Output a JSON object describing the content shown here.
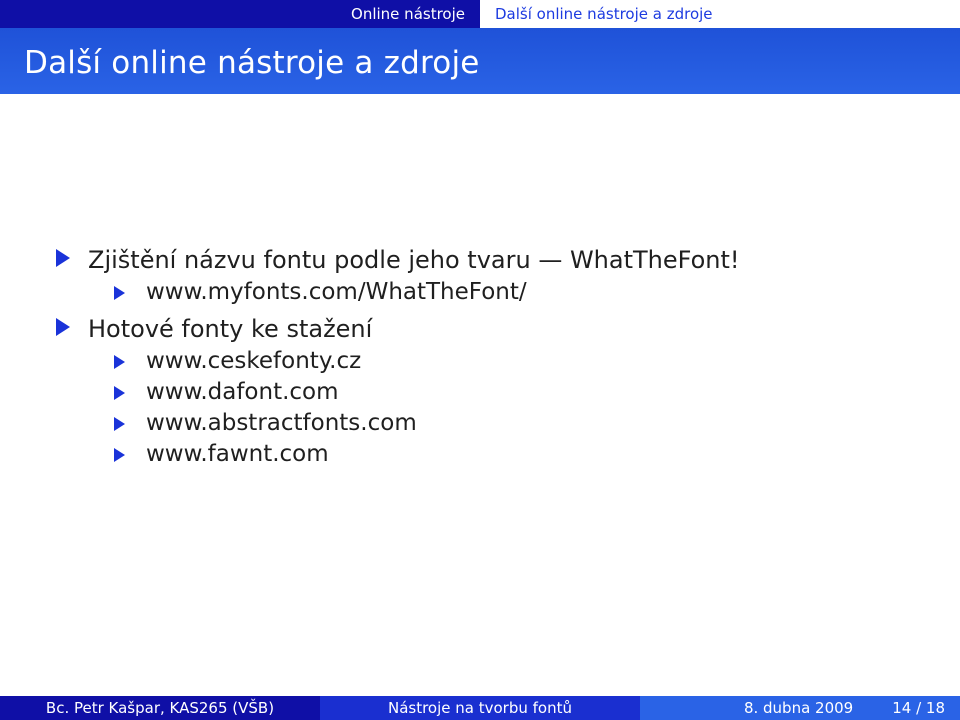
{
  "nav": {
    "section": "Online nástroje",
    "subsection": "Další online nástroje a zdroje"
  },
  "frame": {
    "title": "Další online nástroje a zdroje"
  },
  "items": [
    {
      "text": "Zjištění názvu fontu podle jeho tvaru — WhatTheFont!",
      "subitems": [
        "www.myfonts.com/WhatTheFont/"
      ]
    },
    {
      "text": "Hotové fonty ke stažení",
      "subitems": [
        "www.ceskefonty.cz",
        "www.dafont.com",
        "www.abstractfonts.com",
        "www.fawnt.com"
      ]
    }
  ],
  "footer": {
    "author": "Bc. Petr Kašpar, KAS265 (VŠB)",
    "talk_title": "Nástroje na tvorbu fontů",
    "date": "8. dubna 2009",
    "page": "14 / 18"
  },
  "colors": {
    "nav_dark": "#0f0fa6",
    "title_bar": "#2a63e6",
    "bullet": "#1a33d9",
    "nav_link": "#1d3be0"
  },
  "icons": {
    "bullet": "triangle-bullet-icon"
  }
}
